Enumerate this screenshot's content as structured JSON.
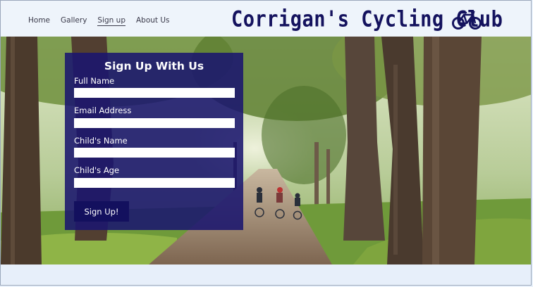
{
  "nav": {
    "items": [
      {
        "label": "Home",
        "active": false
      },
      {
        "label": "Gallery",
        "active": false
      },
      {
        "label": "Sign up",
        "active": true
      },
      {
        "label": "About Us",
        "active": false
      }
    ]
  },
  "brand": {
    "title": "Corrigan's Cycling Club",
    "icon": "bicycle-icon",
    "color": "#14125e"
  },
  "hero": {
    "image": "tree-lined-path-with-cyclists-photo"
  },
  "signup_form": {
    "title": "Sign Up With Us",
    "fields": [
      {
        "label": "Full Name",
        "value": ""
      },
      {
        "label": "Email Address",
        "value": ""
      },
      {
        "label": "Child's Name",
        "value": ""
      },
      {
        "label": "Child's Age",
        "value": ""
      }
    ],
    "submit_label": "Sign Up!",
    "panel_color": "#1a166e"
  }
}
